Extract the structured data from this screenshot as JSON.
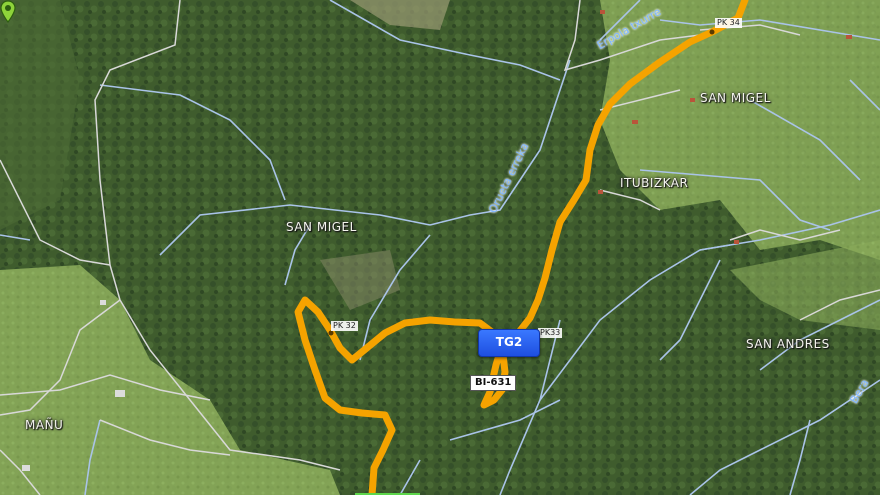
{
  "places": {
    "san_migel_north": "SAN MIGEL",
    "san_migel_center": "SAN MIGEL",
    "itubizkar": "ITUBIZKAR",
    "san_andres": "SAN ANDRES",
    "manu": "MAÑU"
  },
  "rivers": {
    "erpola": "Erpola txurre",
    "orueta": "Orueta erreka",
    "bera": "Bera"
  },
  "kilometer_posts": {
    "pk34": "PK 34",
    "pk32": "PK 32",
    "pk33": "PK33"
  },
  "road": {
    "code": "BI-631",
    "color": "#f5a300"
  },
  "marker": {
    "label": "TG2",
    "color": "#2f66f5"
  },
  "colors": {
    "forest": "#3d5a2c",
    "meadow": "#8fae5e",
    "stream": "#a9c3e8",
    "path": "#d9d9d9"
  }
}
